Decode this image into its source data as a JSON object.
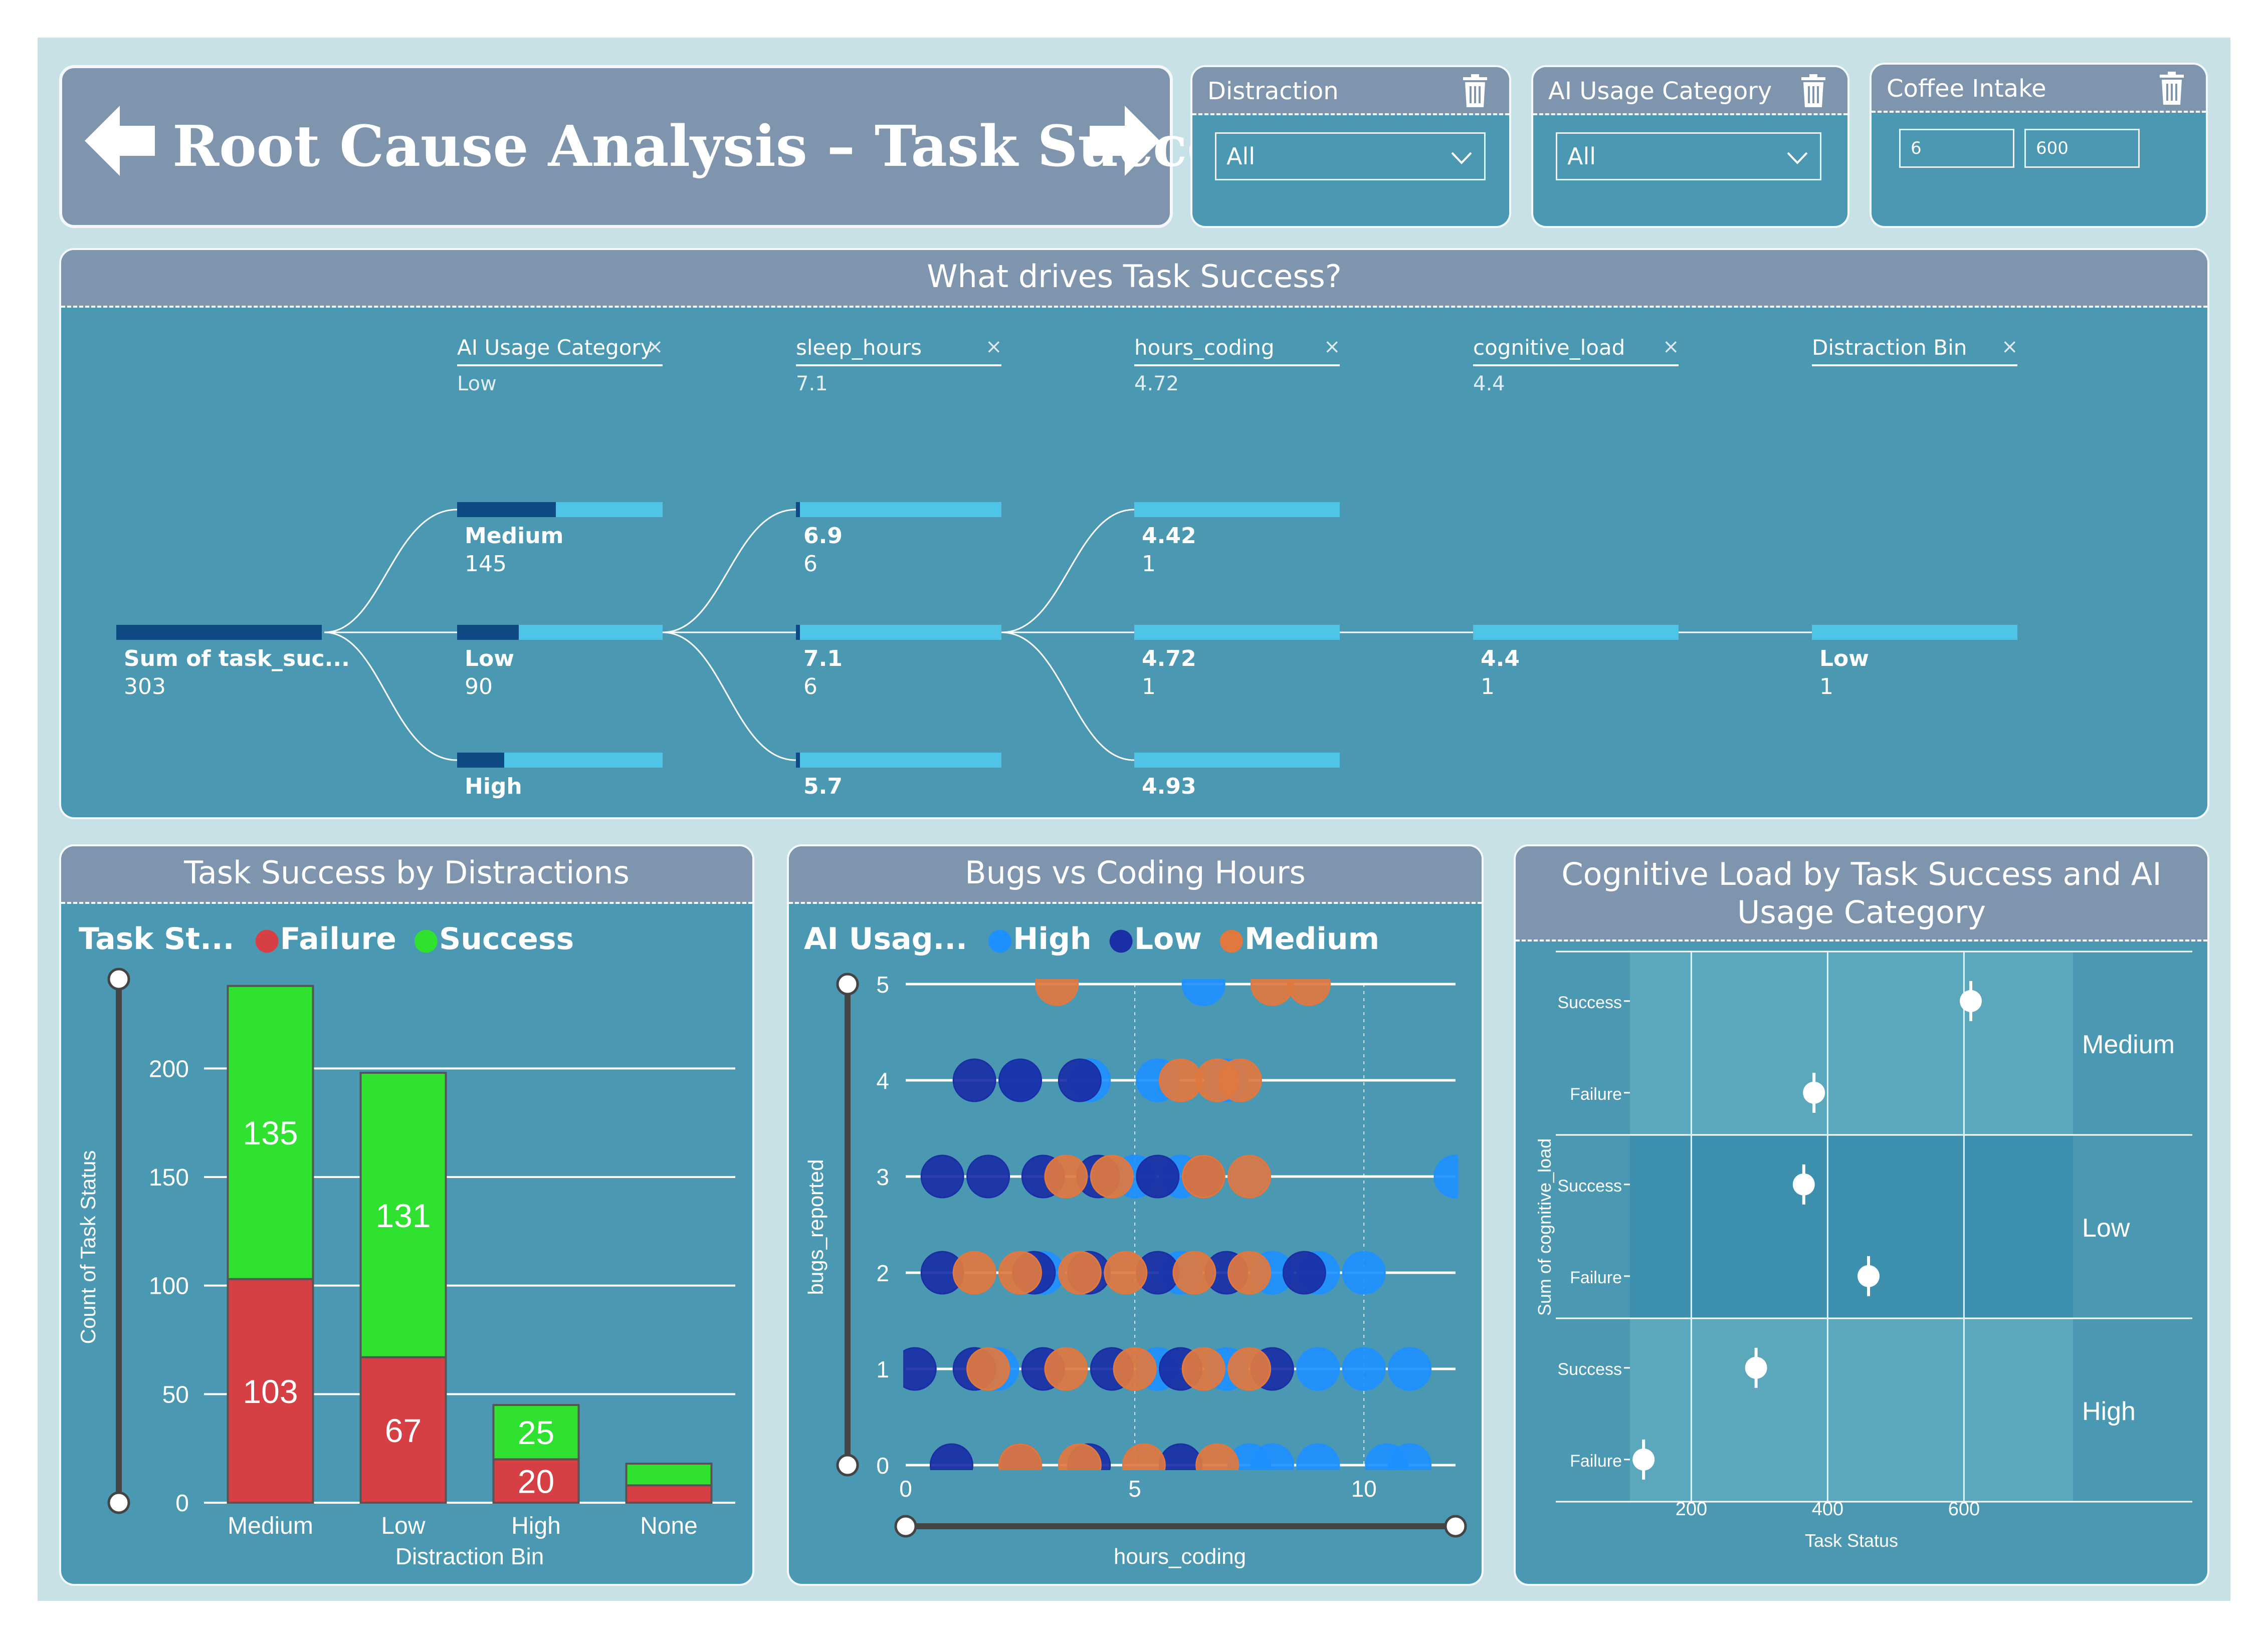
{
  "header": {
    "title": "Root Cause Analysis – Task Success"
  },
  "slicers": {
    "distraction": {
      "label": "Distraction",
      "value": "All"
    },
    "ai_usage": {
      "label": "AI Usage Category",
      "value": "All"
    },
    "coffee": {
      "label": "Coffee Intake",
      "min": "6",
      "max": "600"
    }
  },
  "tree": {
    "title": "What drives Task Success?",
    "levels": [
      {
        "name": "AI Usage Category",
        "value": "Low"
      },
      {
        "name": "sleep_hours",
        "value": "7.1"
      },
      {
        "name": "hours_coding",
        "value": "4.72"
      },
      {
        "name": "cognitive_load",
        "value": "4.4"
      },
      {
        "name": "Distraction Bin",
        "value": ""
      }
    ],
    "root": {
      "label": "Sum of task_suc...",
      "count": "303",
      "fill": 1.0
    },
    "l1": [
      {
        "label": "Medium",
        "count": "145",
        "fill": 0.48
      },
      {
        "label": "Low",
        "count": "90",
        "fill": 0.3
      },
      {
        "label": "High",
        "count": "",
        "fill": 0.23
      }
    ],
    "l2": [
      {
        "label": "6.9",
        "count": "6",
        "fill": 0.02
      },
      {
        "label": "7.1",
        "count": "6",
        "fill": 0.02
      },
      {
        "label": "5.7",
        "count": "",
        "fill": 0.02
      }
    ],
    "l3": [
      {
        "label": "4.42",
        "count": "1",
        "fill": 0
      },
      {
        "label": "4.72",
        "count": "1",
        "fill": 0
      },
      {
        "label": "4.93",
        "count": "",
        "fill": 0
      }
    ],
    "l4": [
      {
        "label": "4.4",
        "count": "1",
        "fill": 0
      }
    ],
    "l5": [
      {
        "label": "Low",
        "count": "1",
        "fill": 0
      }
    ]
  },
  "chart1_title": "Task Success by Distractions",
  "chart2_title": "Bugs vs Coding Hours",
  "chart3_title_line1": "Cognitive Load by Task Success and AI",
  "chart3_title_line2": "Usage Category",
  "chart_data": [
    {
      "type": "bar",
      "title": "Task Success by Distractions",
      "xlabel": "Distraction Bin",
      "ylabel": "Count of Task Status",
      "legend_title": "Task St...",
      "categories": [
        "Medium",
        "Low",
        "High",
        "None"
      ],
      "series": [
        {
          "name": "Failure",
          "color": "#d64045",
          "values": [
            103,
            67,
            20,
            8
          ]
        },
        {
          "name": "Success",
          "color": "#2fe22f",
          "values": [
            135,
            131,
            25,
            10
          ]
        }
      ],
      "data_labels": [
        [
          "103",
          "67",
          "20",
          ""
        ],
        [
          "135",
          "131",
          "25",
          ""
        ]
      ],
      "ylim": [
        0,
        240
      ],
      "yticks": [
        0,
        50,
        100,
        150,
        200
      ],
      "stacked": true,
      "legend": "top-left"
    },
    {
      "type": "scatter",
      "title": "Bugs vs Coding Hours",
      "xlabel": "hours_coding",
      "ylabel": "bugs_reported",
      "legend_title": "AI Usag...",
      "xlim": [
        0,
        12
      ],
      "ylim": [
        0,
        5
      ],
      "xticks": [
        0,
        5,
        10
      ],
      "yticks": [
        0,
        1,
        2,
        3,
        4,
        5
      ],
      "series": [
        {
          "name": "High",
          "color": "#1e90ff",
          "points": [
            [
              6.5,
              5
            ],
            [
              2.5,
              4
            ],
            [
              4,
              4
            ],
            [
              5.5,
              4
            ],
            [
              7,
              4
            ],
            [
              6,
              3
            ],
            [
              5,
              3
            ],
            [
              7.5,
              3
            ],
            [
              12,
              3
            ],
            [
              3,
              2
            ],
            [
              9,
              2
            ],
            [
              10,
              2
            ],
            [
              6,
              2
            ],
            [
              8,
              2
            ],
            [
              7,
              1
            ],
            [
              5.5,
              1
            ],
            [
              9,
              1
            ],
            [
              10,
              1
            ],
            [
              11,
              1
            ],
            [
              2,
              1
            ],
            [
              10.5,
              0
            ],
            [
              11,
              0
            ],
            [
              9,
              0
            ],
            [
              8,
              0
            ],
            [
              7.5,
              0
            ]
          ]
        },
        {
          "name": "Low",
          "color": "#1a2fa5",
          "points": [
            [
              1.5,
              4
            ],
            [
              2.5,
              4
            ],
            [
              3.8,
              4
            ],
            [
              0.8,
              3
            ],
            [
              1.8,
              3
            ],
            [
              3,
              3
            ],
            [
              4.2,
              3
            ],
            [
              5.5,
              3
            ],
            [
              6.5,
              3
            ],
            [
              0.8,
              2
            ],
            [
              2.8,
              2
            ],
            [
              4,
              2
            ],
            [
              5.5,
              2
            ],
            [
              7,
              2
            ],
            [
              8.7,
              2
            ],
            [
              0.2,
              1
            ],
            [
              1.5,
              1
            ],
            [
              3,
              1
            ],
            [
              4.5,
              1
            ],
            [
              6,
              1
            ],
            [
              8,
              1
            ],
            [
              1,
              0
            ],
            [
              2.5,
              0
            ],
            [
              4,
              0
            ],
            [
              6,
              0
            ]
          ]
        },
        {
          "name": "Medium",
          "color": "#e07840",
          "points": [
            [
              3.3,
              5
            ],
            [
              8,
              5
            ],
            [
              8.8,
              5
            ],
            [
              6,
              4
            ],
            [
              6.8,
              4
            ],
            [
              7.3,
              4
            ],
            [
              3.5,
              3
            ],
            [
              4.5,
              3
            ],
            [
              6.5,
              3
            ],
            [
              7.5,
              3
            ],
            [
              1.5,
              2
            ],
            [
              2.5,
              2
            ],
            [
              3.8,
              2
            ],
            [
              4.8,
              2
            ],
            [
              6.3,
              2
            ],
            [
              7.5,
              2
            ],
            [
              1.8,
              1
            ],
            [
              3.5,
              1
            ],
            [
              5,
              1
            ],
            [
              6.5,
              1
            ],
            [
              7.5,
              1
            ],
            [
              2.5,
              0
            ],
            [
              3.8,
              0
            ],
            [
              5.2,
              0
            ],
            [
              6.8,
              0
            ]
          ]
        }
      ],
      "legend": "top-left"
    },
    {
      "type": "scatter",
      "title": "Cognitive Load by Task Success and AI Usage Category",
      "xlabel": "Task Status",
      "ylabel": "Sum of cognitive_load",
      "xlim": [
        110,
        760
      ],
      "xticks": [
        200,
        400,
        600
      ],
      "groups": [
        "Medium",
        "Low",
        "High"
      ],
      "rows": [
        "Success",
        "Failure"
      ],
      "points": [
        {
          "group": "Medium",
          "row": "Success",
          "x": 610
        },
        {
          "group": "Medium",
          "row": "Failure",
          "x": 380
        },
        {
          "group": "Low",
          "row": "Success",
          "x": 365
        },
        {
          "group": "Low",
          "row": "Failure",
          "x": 460
        },
        {
          "group": "High",
          "row": "Success",
          "x": 295
        },
        {
          "group": "High",
          "row": "Failure",
          "x": 130
        }
      ]
    }
  ]
}
